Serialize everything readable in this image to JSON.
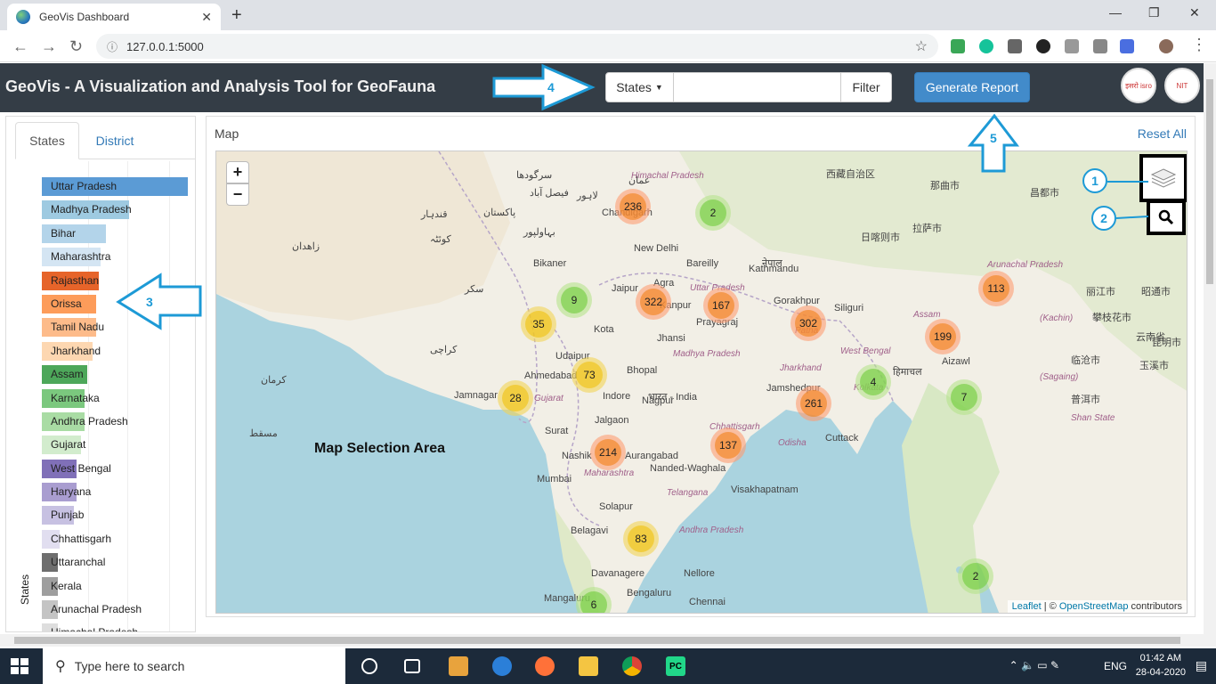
{
  "browser": {
    "tab_title": "GeoVis Dashboard",
    "tab_close": "✕",
    "new_tab": "+",
    "url": "127.0.0.1:5000",
    "minimize": "—",
    "maximize": "❐",
    "close": "✕"
  },
  "navbar": {
    "brand": "GeoVis - A Visualization and Analysis Tool for GeoFauna",
    "dropdown_label": "States",
    "filter_value": "",
    "filter_button": "Filter",
    "report_button": "Generate Report",
    "logo1_text": "इसरो isro",
    "logo2_text": "NIT"
  },
  "sidebar": {
    "tabs": [
      "States",
      "District"
    ],
    "active_tab": "States",
    "yaxis_label": "States",
    "bars": [
      {
        "label": "Uttar Pradesh",
        "value": 100,
        "color": "#5b9bd5"
      },
      {
        "label": "Madhya Pradesh",
        "value": 60,
        "color": "#9ecae1"
      },
      {
        "label": "Bihar",
        "value": 44,
        "color": "#b3d4ea"
      },
      {
        "label": "Maharashtra",
        "value": 40,
        "color": "#d4e5f3"
      },
      {
        "label": "Rajasthan",
        "value": 39,
        "color": "#e6642a"
      },
      {
        "label": "Orissa",
        "value": 37,
        "color": "#fd9c5a"
      },
      {
        "label": "Tamil Nadu",
        "value": 37,
        "color": "#fdbb8a"
      },
      {
        "label": "Jharkhand",
        "value": 35,
        "color": "#fdd7b1"
      },
      {
        "label": "Assam",
        "value": 31,
        "color": "#4da75a"
      },
      {
        "label": "Karnataka",
        "value": 29,
        "color": "#7bc87e"
      },
      {
        "label": "Andhra Pradesh",
        "value": 29,
        "color": "#a9dca4"
      },
      {
        "label": "Gujarat",
        "value": 27,
        "color": "#d2eccd"
      },
      {
        "label": "West Bengal",
        "value": 24,
        "color": "#8070b8"
      },
      {
        "label": "Haryana",
        "value": 24,
        "color": "#a99dd0"
      },
      {
        "label": "Punjab",
        "value": 22,
        "color": "#c7c1e2"
      },
      {
        "label": "Chhattisgarh",
        "value": 12,
        "color": "#e1def0"
      },
      {
        "label": "Uttaranchal",
        "value": 11,
        "color": "#6e6e6e"
      },
      {
        "label": "Kerala",
        "value": 11,
        "color": "#9e9e9e"
      },
      {
        "label": "Arunachal Pradesh",
        "value": 11,
        "color": "#c4c4c4"
      },
      {
        "label": "Himachal Pradesh",
        "value": 11,
        "color": "#dedede"
      }
    ]
  },
  "map": {
    "title": "Map",
    "reset": "Reset All",
    "zoom_in": "+",
    "zoom_out": "−",
    "selection_label": "Map Selection Area",
    "attribution": {
      "leaflet": "Leaflet",
      "sep": " | © ",
      "osm": "OpenStreetMap",
      "tail": " contributors"
    },
    "clusters": [
      {
        "count": "236",
        "color": "orange"
      },
      {
        "count": "2",
        "color": "green"
      },
      {
        "count": "9",
        "color": "green"
      },
      {
        "count": "322",
        "color": "orange"
      },
      {
        "count": "167",
        "color": "orange"
      },
      {
        "count": "302",
        "color": "orange"
      },
      {
        "count": "113",
        "color": "orange"
      },
      {
        "count": "35",
        "color": "yellow"
      },
      {
        "count": "199",
        "color": "orange"
      },
      {
        "count": "73",
        "color": "yellow"
      },
      {
        "count": "4",
        "color": "green"
      },
      {
        "count": "7",
        "color": "green"
      },
      {
        "count": "28",
        "color": "yellow"
      },
      {
        "count": "261",
        "color": "orange"
      },
      {
        "count": "214",
        "color": "orange"
      },
      {
        "count": "137",
        "color": "orange"
      },
      {
        "count": "83",
        "color": "yellow"
      },
      {
        "count": "2",
        "color": "green"
      },
      {
        "count": "6",
        "color": "green"
      }
    ],
    "places": [
      "Chandigarh",
      "New Delhi",
      "Bareilly",
      "Kathmandu",
      "Bikaner",
      "Jaipur",
      "Agra",
      "Kanpur",
      "Prayagraj",
      "Gorakhpur",
      "Siliguri",
      "Kota",
      "Jhansi",
      "Patna",
      "Udaipur",
      "Ahmedabad",
      "Bhopal",
      "Jamnagar",
      "Indore",
      "Jamshedpur",
      "Kolkata",
      "Aizawl",
      "Surat",
      "Jalgaon",
      "Nagpur",
      "Cuttack",
      "Nashik",
      "Aurangabad",
      "Nanded-Waghala",
      "Mumbai",
      "Visakhapatnam",
      "Solapur",
      "Belagavi",
      "Davanagere",
      "Nellore",
      "Mangaluru",
      "Bengaluru",
      "Chennai",
      "Assam",
      "West Bengal",
      "Jharkhand",
      "Madhya Pradesh",
      "Uttar Pradesh",
      "Himachal Pradesh",
      "Arunachal Pradesh",
      "Maharashtra",
      "Chhattisgarh",
      "Odisha",
      "Telangana",
      "Andhra Pradesh",
      "Gujarat",
      "Shan State",
      "(Kachin)",
      "(Sagaing)",
      "भारत - India",
      "नेपाल",
      "西藏自治区",
      "那曲市",
      "昌都市",
      "日喀则市",
      "拉萨市",
      "丽江市",
      "昭通市",
      "攀枝花市",
      "云南省",
      "昆明市",
      "临沧市",
      "玉溪市",
      "普洱市",
      "پاکستان",
      "لاہور",
      "فیصل آباد",
      "سرگودھا",
      "قندہار",
      "کوئٹہ",
      "بہاولپور",
      "سکر",
      "کراچی",
      "زاهدان",
      "کرمان",
      "مسقط",
      "عمان",
      "हिमाचल",
      "बांग्लादेश"
    ],
    "annotations": [
      "1",
      "2",
      "3",
      "4",
      "5"
    ]
  },
  "taskbar": {
    "search_placeholder": "Type here to search",
    "lang": "ENG",
    "time": "01:42 AM",
    "date": "28-04-2020"
  }
}
